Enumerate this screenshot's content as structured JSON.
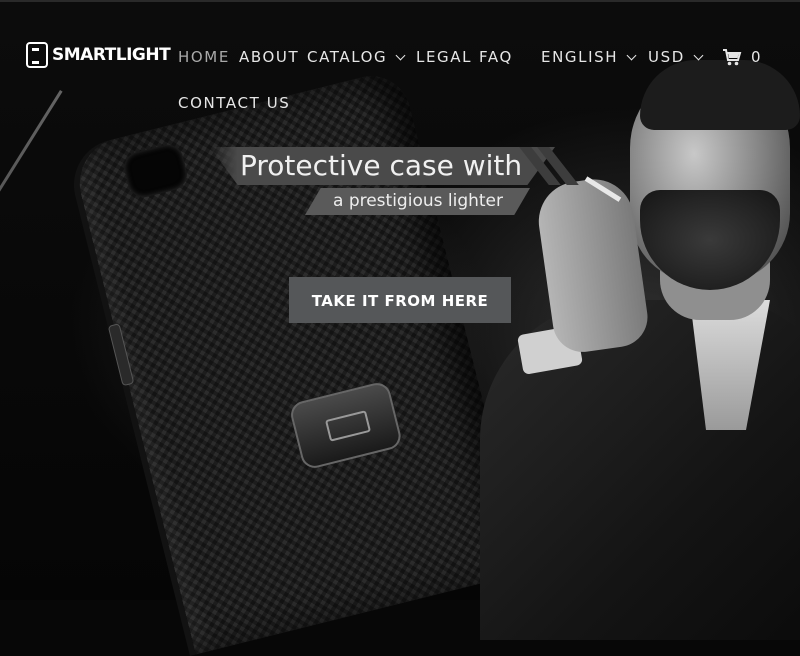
{
  "brand": {
    "logo_text": "SMARTLIGHT"
  },
  "nav": {
    "items": [
      {
        "label": "HOME",
        "active": true
      },
      {
        "label": "ABOUT"
      },
      {
        "label": "CATALOG"
      },
      {
        "label": "LEGAL"
      },
      {
        "label": "FAQ"
      },
      {
        "label": "CONTACT US"
      }
    ],
    "language": "ENGLISH",
    "currency": "USD",
    "cart_count": "0"
  },
  "hero": {
    "title": "Protective case with",
    "subtitle": "a prestigious lighter",
    "cta_label": "TAKE IT FROM HERE"
  },
  "colors": {
    "background": "#070707",
    "cta_bg": "#555759",
    "banner_bg": "#4a4a4a",
    "active_nav": "#a9a9a9"
  },
  "icons": [
    "logo-mark-icon",
    "chevron-down-icon",
    "cart-icon"
  ]
}
